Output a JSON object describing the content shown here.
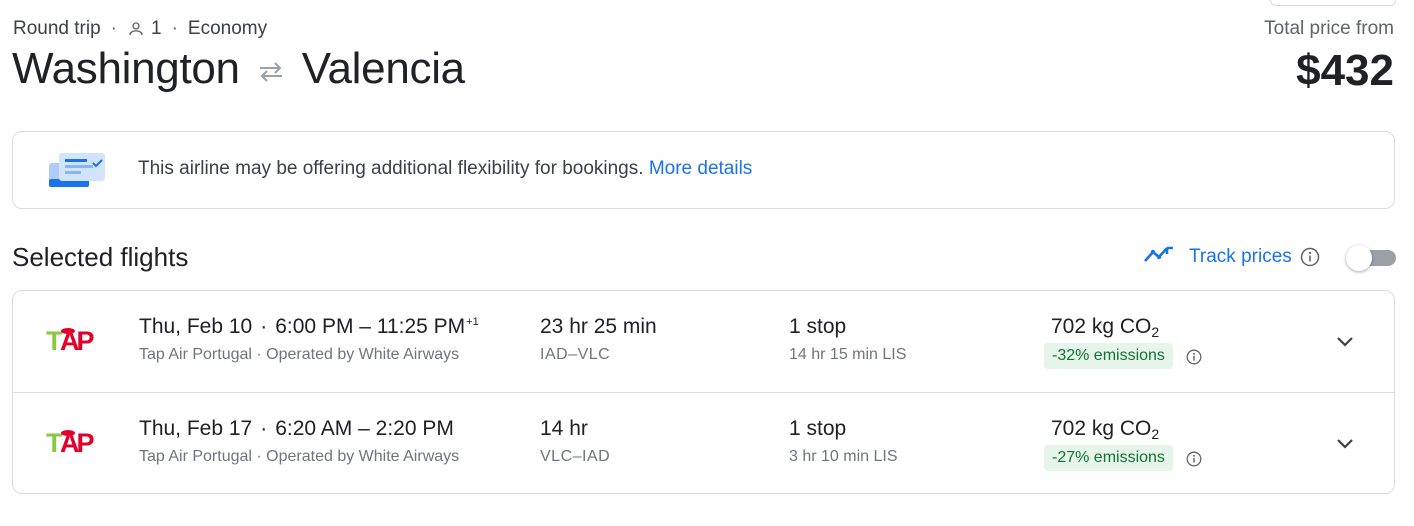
{
  "header": {
    "trip_type": "Round trip",
    "passengers": "1",
    "cabin": "Economy",
    "origin": "Washington",
    "destination": "Valencia",
    "price_label": "Total price from",
    "price": "$432"
  },
  "notice": {
    "text": "This airline may be offering additional flexibility for bookings.",
    "link": "More details"
  },
  "section": {
    "title": "Selected flights",
    "track_label": "Track prices",
    "track_enabled": false
  },
  "flights": [
    {
      "date": "Thu, Feb 10",
      "depart": "6:00 PM",
      "dash": "–",
      "arrive": "11:25 PM",
      "day_offset": "+1",
      "airline": "Tap Air Portugal",
      "operated": "Operated by White Airways",
      "duration": "23 hr 25 min",
      "airports": "IAD–VLC",
      "stops": "1 stop",
      "layover": "14 hr 15 min LIS",
      "co2": "702 kg CO",
      "co2_sub": "2",
      "emissions": "-32% emissions"
    },
    {
      "date": "Thu, Feb 17",
      "depart": "6:20 AM",
      "dash": "–",
      "arrive": "2:20 PM",
      "day_offset": "",
      "airline": "Tap Air Portugal",
      "operated": "Operated by White Airways",
      "duration": "14 hr",
      "airports": "VLC–IAD",
      "stops": "1 stop",
      "layover": "3 hr 10 min LIS",
      "co2": "702 kg CO",
      "co2_sub": "2",
      "emissions": "-27% emissions"
    }
  ],
  "colors": {
    "accent": "#1a73e8",
    "emissions_bg": "#e6f4ea",
    "emissions_text": "#137333",
    "tap_green": "#8dc63f",
    "tap_red": "#e4002b"
  },
  "icons": {
    "person": "person-icon",
    "swap": "swap-arrows-icon",
    "notice": "flexible-booking-illustration-icon",
    "trend": "trending-line-icon",
    "info": "info-icon",
    "expand": "chevron-down-icon",
    "airline_logo": "tap-logo-icon"
  }
}
